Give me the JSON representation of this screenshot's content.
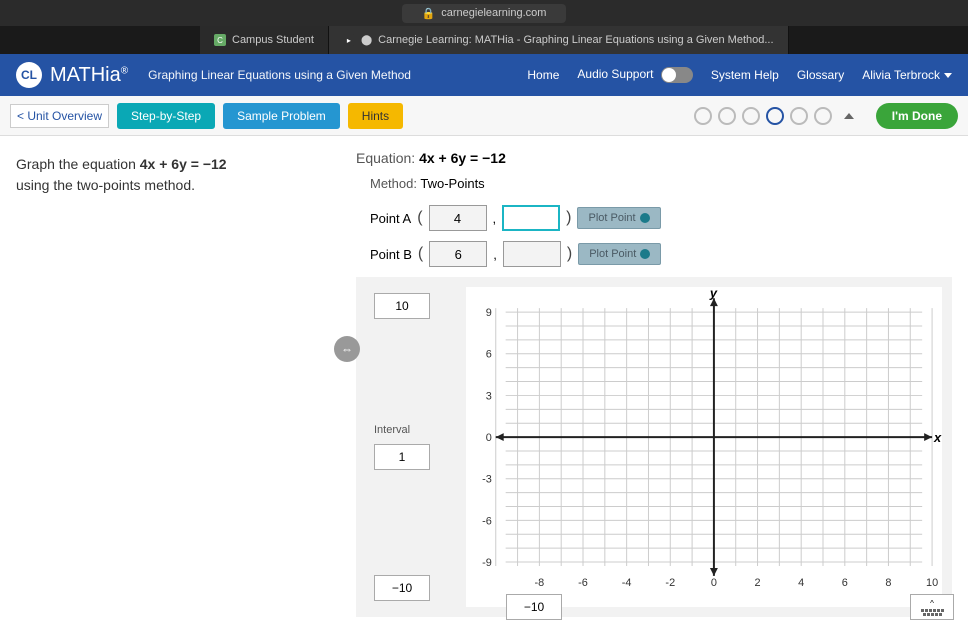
{
  "browser": {
    "url": "carnegielearning.com",
    "tabs": [
      {
        "label": "Campus Student"
      },
      {
        "label": "Carnegie Learning: MATHia - Graphing Linear Equations using a Given Method..."
      }
    ]
  },
  "header": {
    "app": "MATHia",
    "reg": "®",
    "subtitle": "Graphing Linear Equations using a Given Method",
    "links": {
      "home": "Home",
      "audio": "Audio Support",
      "help": "System Help",
      "glossary": "Glossary",
      "user": "Alivia Terbrock"
    }
  },
  "toolbar": {
    "back": "< Unit Overview",
    "step": "Step-by-Step",
    "sample": "Sample Problem",
    "hints": "Hints",
    "done": "I'm Done"
  },
  "prompt": {
    "pre": "Graph the equation ",
    "eq": "4x + 6y = −12",
    "post": " using the two-points method."
  },
  "work": {
    "eq_label": "Equation:",
    "eq": "4x + 6y = −12",
    "method_label": "Method:",
    "method": "Two-Points",
    "pointA": {
      "label": "Point A",
      "x": "4",
      "y": "",
      "btn": "Plot Point"
    },
    "pointB": {
      "label": "Point B",
      "x": "6",
      "y": "",
      "btn": "Plot Point"
    }
  },
  "graph": {
    "ymax": "10",
    "interval_label": "Interval",
    "interval": "1",
    "ymin": "−10",
    "xmin": "−10",
    "x_axis_label": "x",
    "y_axis_label": "y"
  },
  "chart_data": {
    "type": "scatter",
    "title": "",
    "xlabel": "x",
    "ylabel": "y",
    "xlim": [
      -10,
      10
    ],
    "ylim": [
      -10,
      10
    ],
    "x_ticks": [
      -8,
      -6,
      -4,
      -2,
      0,
      2,
      4,
      6,
      8,
      10
    ],
    "y_ticks": [
      -9,
      -6,
      -3,
      0,
      3,
      6,
      9
    ],
    "grid_interval": 1,
    "series": []
  }
}
